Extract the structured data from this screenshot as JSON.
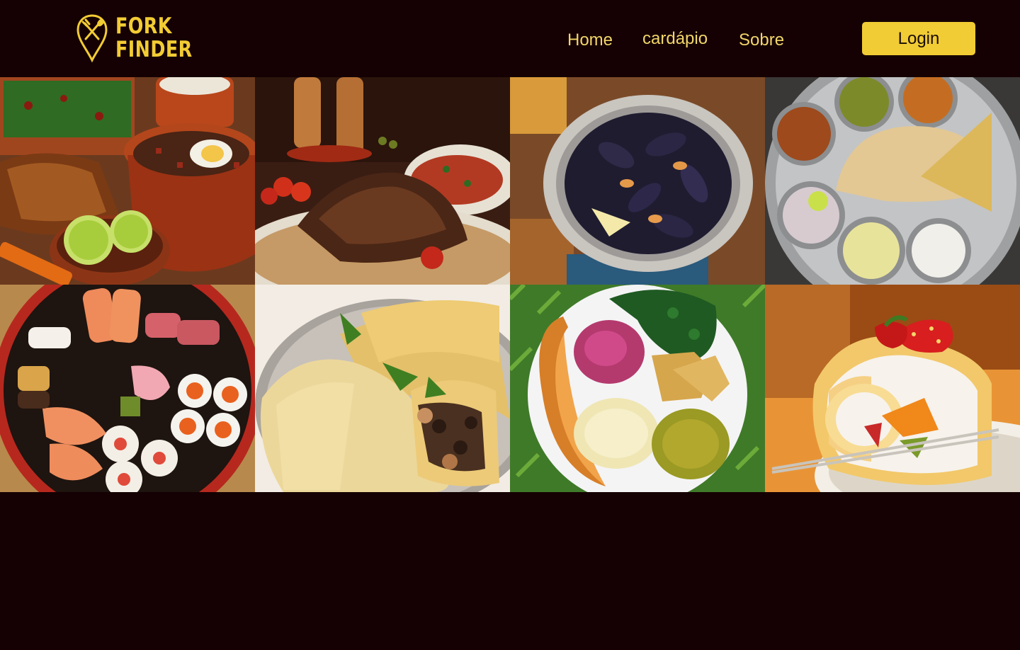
{
  "brand": {
    "line1": "FORK",
    "line2": "FINDER",
    "logo_icon": "fork-knife-pin-icon",
    "accent_color": "#f2cc34"
  },
  "nav": {
    "home": "Home",
    "menu": "cardápio",
    "about": "Sobre",
    "login": "Login"
  },
  "colors": {
    "background": "#150003",
    "nav_text": "#f2d66a",
    "button": "#f2cc34"
  },
  "gallery": [
    {
      "name": "feijoada-photo",
      "icon": "food-image"
    },
    {
      "name": "lamb-rice-photo",
      "icon": "food-image"
    },
    {
      "name": "mussels-photo",
      "icon": "food-image"
    },
    {
      "name": "indian-thali-photo",
      "icon": "food-image"
    },
    {
      "name": "sushi-platter-photo",
      "icon": "food-image"
    },
    {
      "name": "tacos-photo",
      "icon": "food-image"
    },
    {
      "name": "vegetarian-plate-photo",
      "icon": "food-image"
    },
    {
      "name": "strawberry-roll-cake-photo",
      "icon": "food-image"
    }
  ]
}
